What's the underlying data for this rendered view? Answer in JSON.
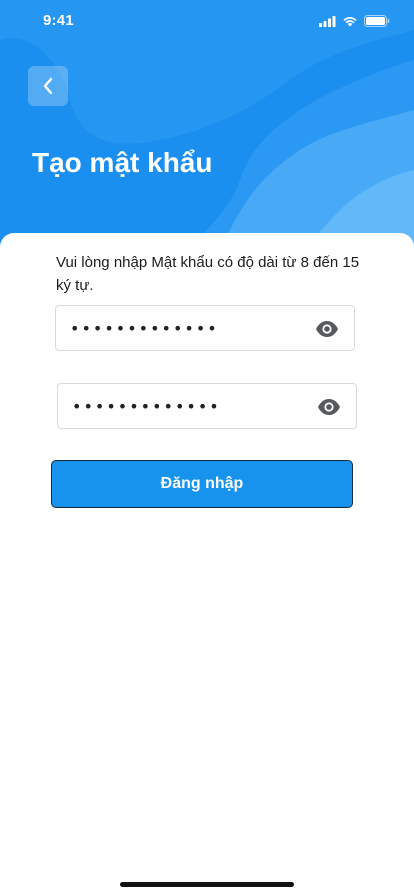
{
  "status_bar": {
    "time": "9:41",
    "icons": [
      "signal-icon",
      "wifi-icon",
      "battery-icon"
    ]
  },
  "header": {
    "back_icon": "chevron-left-icon",
    "title": "Tạo mật khẩu"
  },
  "form": {
    "instruction": "Vui lòng nhập Mật khẩu có độ dài từ 8 đến 15 ký tự.",
    "password_value": "•••••••••••••",
    "confirm_value": "•••••••••••••",
    "toggle_icon": "eye-icon",
    "submit_label": "Đăng nhập"
  },
  "colors": {
    "header_blue": "#1a8ff0",
    "button_blue": "#1793ee",
    "text_dark": "#1c1c1c",
    "field_border": "#d6d9de"
  }
}
